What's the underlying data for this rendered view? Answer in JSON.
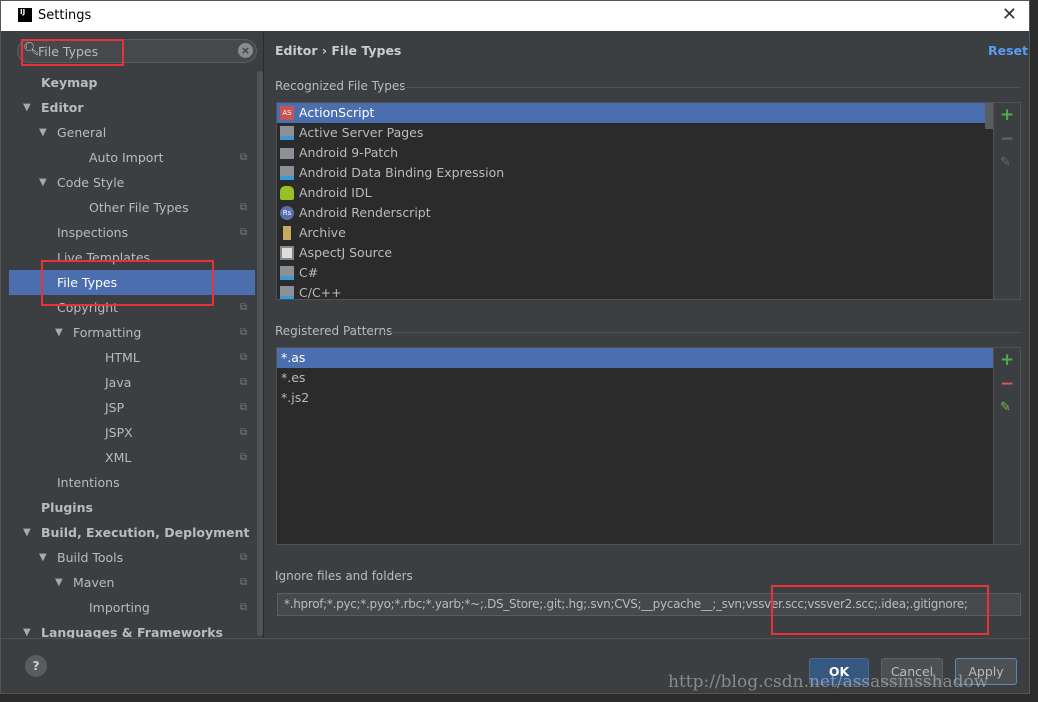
{
  "window": {
    "title": "Settings",
    "logo": "IJ"
  },
  "search": {
    "value": "File Types"
  },
  "sidebar": {
    "items": [
      {
        "label": "Keymap"
      },
      {
        "label": "Editor"
      },
      {
        "label": "General"
      },
      {
        "label": "Auto Import"
      },
      {
        "label": "Code Style"
      },
      {
        "label": "Other File Types"
      },
      {
        "label": "Inspections"
      },
      {
        "label": "Live Templates"
      },
      {
        "label": "File Types"
      },
      {
        "label": "Copyright"
      },
      {
        "label": "Formatting"
      },
      {
        "label": "HTML"
      },
      {
        "label": "Java"
      },
      {
        "label": "JSP"
      },
      {
        "label": "JSPX"
      },
      {
        "label": "XML"
      },
      {
        "label": "Intentions"
      },
      {
        "label": "Plugins"
      },
      {
        "label": "Build, Execution, Deployment"
      },
      {
        "label": "Build Tools"
      },
      {
        "label": "Maven"
      },
      {
        "label": "Importing"
      },
      {
        "label": "Languages & Frameworks"
      }
    ]
  },
  "breadcrumb": {
    "parent": "Editor",
    "sep": "›",
    "current": "File Types"
  },
  "reset_label": "Reset",
  "recognized": {
    "label": "Recognized File Types",
    "items": [
      "ActionScript",
      "Active Server Pages",
      "Android 9-Patch",
      "Android Data Binding Expression",
      "Android IDL",
      "Android Renderscript",
      "Archive",
      "AspectJ Source",
      "C#",
      "C/C++"
    ],
    "icons": [
      "actionscript-icon",
      "file-user-icon",
      "folder-icon",
      "file-user-icon",
      "android-icon",
      "renderscript-icon",
      "archive-icon",
      "aspectj-icon",
      "file-user-icon",
      "file-user-icon"
    ]
  },
  "patterns": {
    "label": "Registered Patterns",
    "items": [
      "*.as",
      "*.es",
      "*.js2"
    ]
  },
  "ignore": {
    "label": "Ignore files and folders",
    "value": "*.hprof;*.pyc;*.pyo;*.rbc;*.yarb;*~;.DS_Store;.git;.hg;.svn;CVS;__pycache__;_svn;vssver.scc;vssver2.scc;.idea;.gitignore;"
  },
  "buttons": {
    "ok": "OK",
    "cancel": "Cancel",
    "apply": "Apply",
    "help": "?"
  },
  "watermark": "http://blog.csdn.net/assassinsshadow",
  "colors": {
    "selection": "#4b6eaf",
    "highlight_box": "#e8313a",
    "add": "#4caf50",
    "remove": "#e05555"
  }
}
